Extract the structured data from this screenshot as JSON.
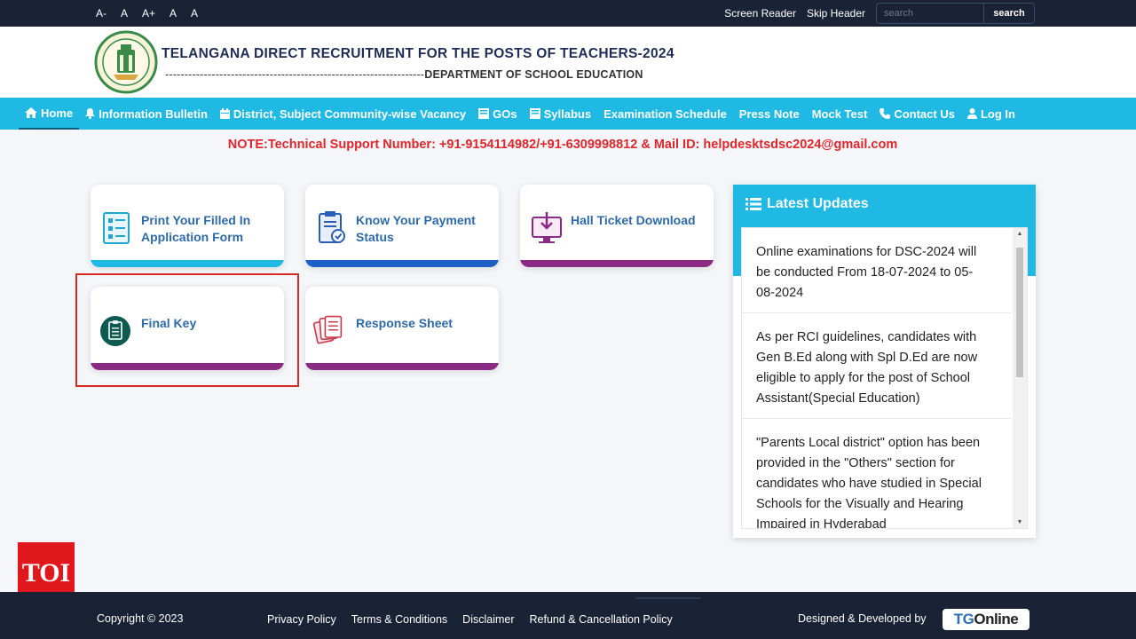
{
  "topbar": {
    "font_sizes": [
      "A-",
      "A",
      "A+",
      "A",
      "A"
    ],
    "screen_reader": "Screen Reader",
    "skip_header": "Skip Header",
    "search_placeholder": "search",
    "search_button": "search"
  },
  "header": {
    "title": "TELANGANA DIRECT RECRUITMENT FOR THE POSTS OF TEACHERS-2024",
    "subtitle_dashes": "-------------------------------------------------------------------",
    "subtitle_dept": "DEPARTMENT OF SCHOOL EDUCATION"
  },
  "nav": [
    {
      "label": "Home",
      "icon": "home-icon"
    },
    {
      "label": "Information Bulletin",
      "icon": "bell-icon"
    },
    {
      "label": "District, Subject Community-wise Vacancy",
      "icon": "calendar-icon"
    },
    {
      "label": "GOs",
      "icon": "book-icon"
    },
    {
      "label": "Syllabus",
      "icon": "book-icon"
    },
    {
      "label": "Examination Schedule",
      "icon": ""
    },
    {
      "label": "Press Note",
      "icon": ""
    },
    {
      "label": "Mock Test",
      "icon": ""
    },
    {
      "label": "Contact Us",
      "icon": "phone-icon"
    },
    {
      "label": "Log In",
      "icon": "user-icon"
    }
  ],
  "note": "NOTE:Technical Support Number: +91-9154114982/+91-6309998812 & Mail ID: helpdesktsdsc2024@gmail.com",
  "cards": [
    {
      "line1": "Print Your Filled In",
      "line2": "Application Form",
      "icon": "form-list-icon",
      "bar_color": "#1fb9e4"
    },
    {
      "line1": "Know Your Payment",
      "line2": "Status",
      "icon": "payment-status-icon",
      "bar_color": "#1b5fc7"
    },
    {
      "line1": "Hall Ticket Download",
      "line2": "",
      "icon": "download-monitor-icon",
      "bar_color": "#8a2a82"
    },
    {
      "line1": "Final Key",
      "line2": "",
      "icon": "clipboard-icon",
      "bar_color": "#8a2a82"
    },
    {
      "line1": "Response Sheet",
      "line2": "",
      "icon": "documents-icon",
      "bar_color": "#8a2a82"
    }
  ],
  "updates": {
    "title": "Latest Updates",
    "items": [
      "Online examinations for DSC-2024 will be conducted From 18-07-2024 to 05-08-2024",
      "As per RCI guidelines, candidates with Gen B.Ed along with Spl D.Ed are now eligible to apply for the post of School Assistant(Special Education)",
      "\"Parents Local district\" option has been provided in the \"Others\" section for candidates who have studied in Special Schools for the Visually and Hearing Impaired in Hyderabad"
    ]
  },
  "footer": {
    "copyright": "Copyright © 2023",
    "links": [
      "Privacy Policy",
      "Terms & Conditions",
      "Disclaimer",
      "Refund & Cancellation Policy"
    ],
    "designed": "Designed & Developed by",
    "brand_tg": "TG",
    "brand_online": "Online"
  },
  "watermark": "TOI",
  "colors": {
    "topbar": "#1a2235",
    "nav": "#1fb9e4",
    "note": "#e0262b",
    "highlight": "#d62a2a"
  }
}
